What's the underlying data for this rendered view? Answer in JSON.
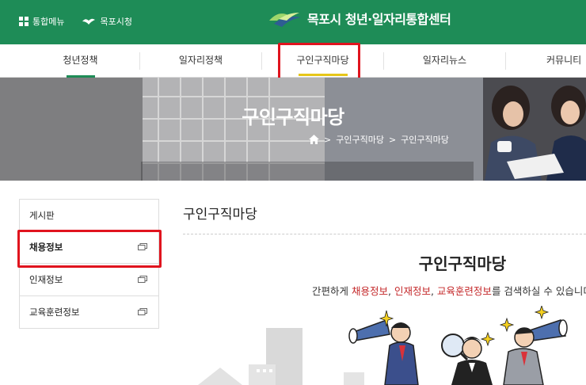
{
  "top": {
    "menu_label": "통합메뉴",
    "city_label": "목포시청",
    "logo_text": "목포시 청년·일자리통합센터"
  },
  "nav": [
    {
      "label": "청년정책"
    },
    {
      "label": "일자리정책"
    },
    {
      "label": "구인구직마당"
    },
    {
      "label": "일자리뉴스"
    },
    {
      "label": "커뮤니티"
    }
  ],
  "hero": {
    "title": "구인구직마당",
    "breadcrumb": [
      "구인구직마당",
      "구인구직마당"
    ]
  },
  "sidebar": [
    {
      "label": "게시판"
    },
    {
      "label": "채용정보"
    },
    {
      "label": "인재정보"
    },
    {
      "label": "교육훈련정보"
    }
  ],
  "main": {
    "title": "구인구직마당",
    "section_title": "구인구직마당",
    "desc": {
      "prefix": "간편하게 ",
      "link1": "채용정보",
      "sep1": ", ",
      "link2": "인재정보",
      "sep2": ", ",
      "link3": "교육훈련정보",
      "suffix": "를 검색하실 수 있습니다"
    }
  },
  "colors": {
    "brand_green": "#1e8c57",
    "highlight_red": "#e0141e",
    "link_red": "#c4282a",
    "nav_active_yellow": "#e6c619"
  }
}
